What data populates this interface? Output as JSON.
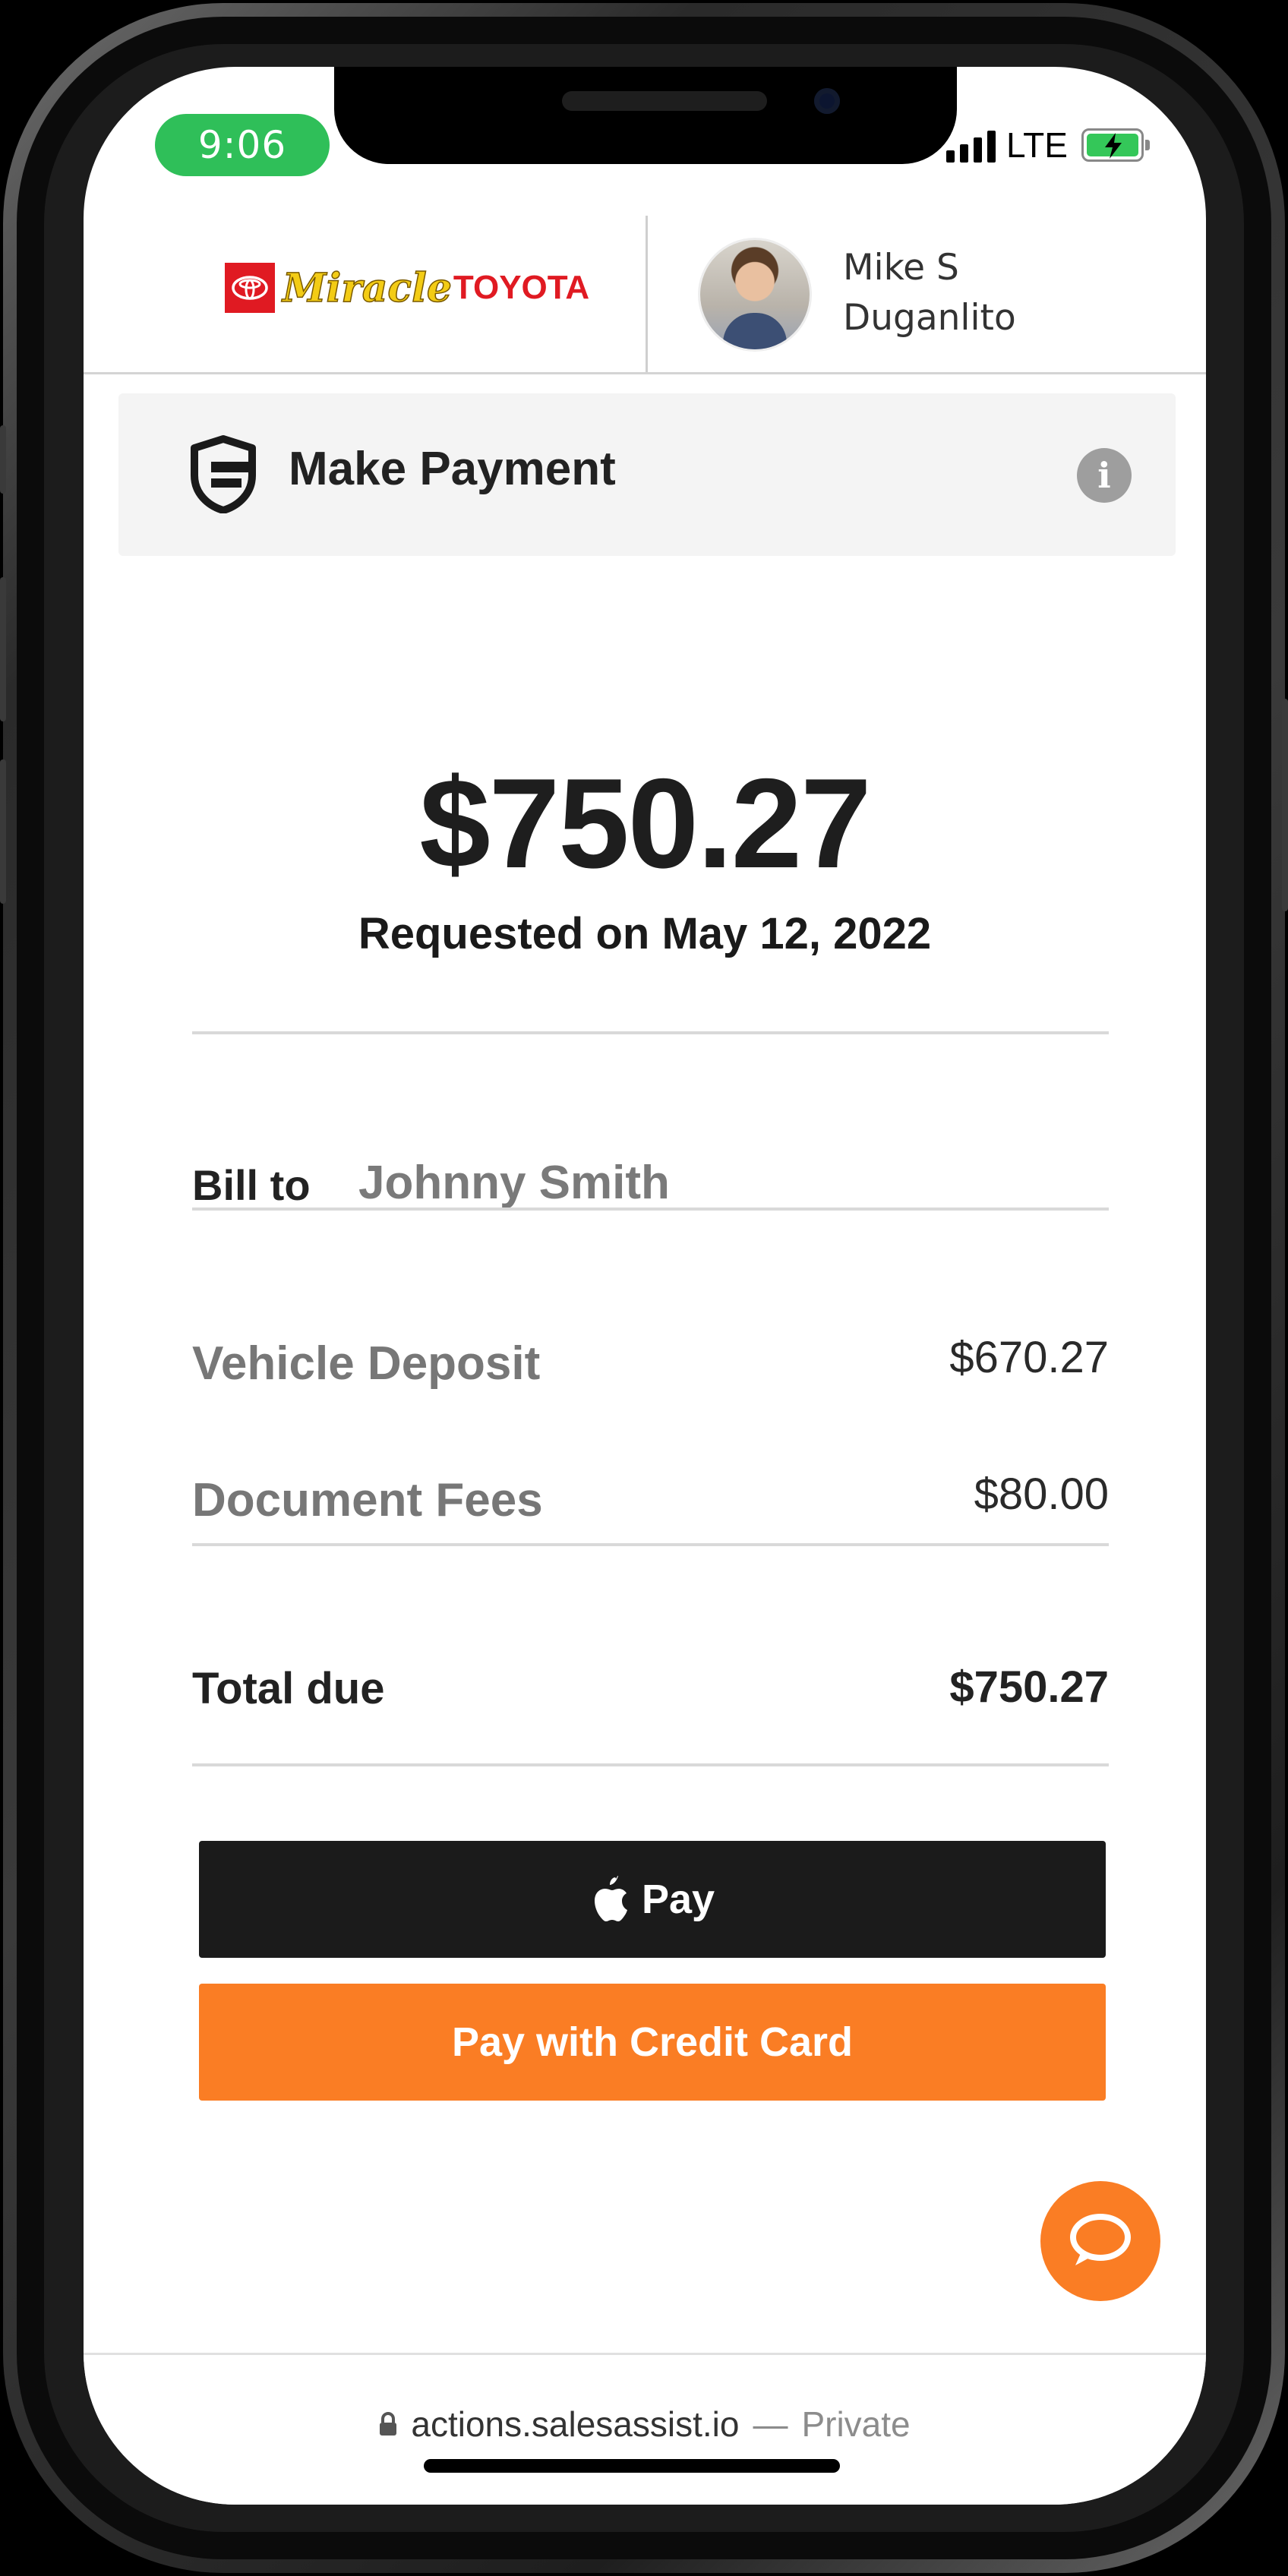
{
  "status_bar": {
    "time": "9:06",
    "network": "LTE",
    "signal_icon": "signal-bars-icon",
    "battery_icon": "battery-charging-icon",
    "battery_color": "#34c759",
    "time_pill_color": "#2fbf59"
  },
  "header": {
    "dealer_logo": {
      "badge_icon": "toyota-emblem-icon",
      "script": "Miracle",
      "word": "TOYOTA"
    },
    "agent": {
      "avatar_icon": "agent-avatar",
      "name_line1": "Mike S",
      "name_line2": "Duganlito"
    }
  },
  "panel": {
    "icon": "shield-card-icon",
    "title": "Make Payment",
    "info_icon": "info-icon",
    "info_glyph": "i"
  },
  "payment": {
    "amount": "$750.27",
    "requested": "Requested on May 12, 2022",
    "bill_to_label": "Bill to",
    "bill_to_name": "Johnny Smith",
    "line_items": [
      {
        "label": "Vehicle Deposit",
        "value": "$670.27"
      },
      {
        "label": "Document Fees",
        "value": "$80.00"
      }
    ],
    "total_label": "Total due",
    "total_value": "$750.27"
  },
  "actions": {
    "apple_pay_label": "Pay",
    "apple_icon": "apple-icon",
    "credit_card_label": "Pay with Credit Card",
    "accent_color": "#fa7d24",
    "chat_icon": "chat-bubble-icon"
  },
  "browser": {
    "lock_icon": "lock-icon",
    "host": "actions.salesassist.io",
    "separator": "—",
    "privacy": "Private"
  }
}
